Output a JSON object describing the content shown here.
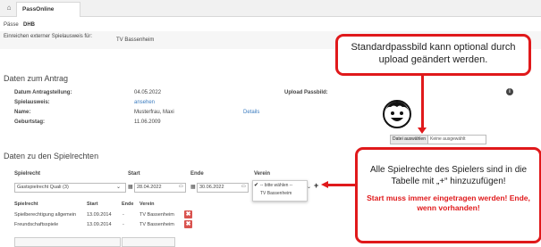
{
  "tabbar": {
    "home_icon": "home-icon",
    "tab_label": "PassOnline"
  },
  "context": {
    "label": "Pässe",
    "value": "DHB"
  },
  "intro": {
    "label": "Einreichen externer Spielausweis für:",
    "value": "TV Bassenheim"
  },
  "antrag": {
    "heading": "Daten zum Antrag",
    "datum_label": "Datum Antragstellung:",
    "datum_value": "04.05.2022",
    "spielausweis_label": "Spielausweis:",
    "spielausweis_link": "ansehen",
    "name_label": "Name:",
    "name_value": "Musterfrau, Maxi",
    "details_link": "Details",
    "geburtstag_label": "Geburtstag:",
    "geburtstag_value": "11.06.2009",
    "upload_label": "Upload Passbild:",
    "file_button": "Datei auswählen",
    "file_status": "Keine ausgewählt",
    "info_icon": "info-icon"
  },
  "spielrechte": {
    "heading": "Daten zu den Spielrechten",
    "col_spielrecht": "Spielrecht",
    "col_start": "Start",
    "col_ende": "Ende",
    "col_verein": "Verein",
    "selected_spielrecht": "Gastspielrecht Quali (3)",
    "start_value": "28.04.2022",
    "ende_value": "30.06.2022",
    "verein_options": [
      "-- bitte wählen --",
      "TV Bassenheim"
    ],
    "add_symbol": "+",
    "table_headers": [
      "Spielrecht",
      "Start",
      "Ende",
      "Verein"
    ],
    "rows": [
      {
        "spielrecht": "Spielberechtigung allgemein",
        "start": "13.09.2014",
        "ende": "-",
        "verein": "TV Bassenheim"
      },
      {
        "spielrecht": "Freundschaftsspiele",
        "start": "13.09.2014",
        "ende": "-",
        "verein": "TV Bassenheim"
      }
    ],
    "delete_symbol": "✖"
  },
  "callouts": {
    "top": "Standardpassbild kann optional durch upload geändert werden.",
    "bottom_line1": "Alle Spielrechte des Spielers sind in die Tabelle mit „+“ hinzuzufügen!",
    "bottom_line2": "Start muss immer eingetragen werden! Ende, wenn vorhanden!"
  },
  "colors": {
    "accent_red": "#e0191b",
    "link": "#3a7bbf"
  }
}
